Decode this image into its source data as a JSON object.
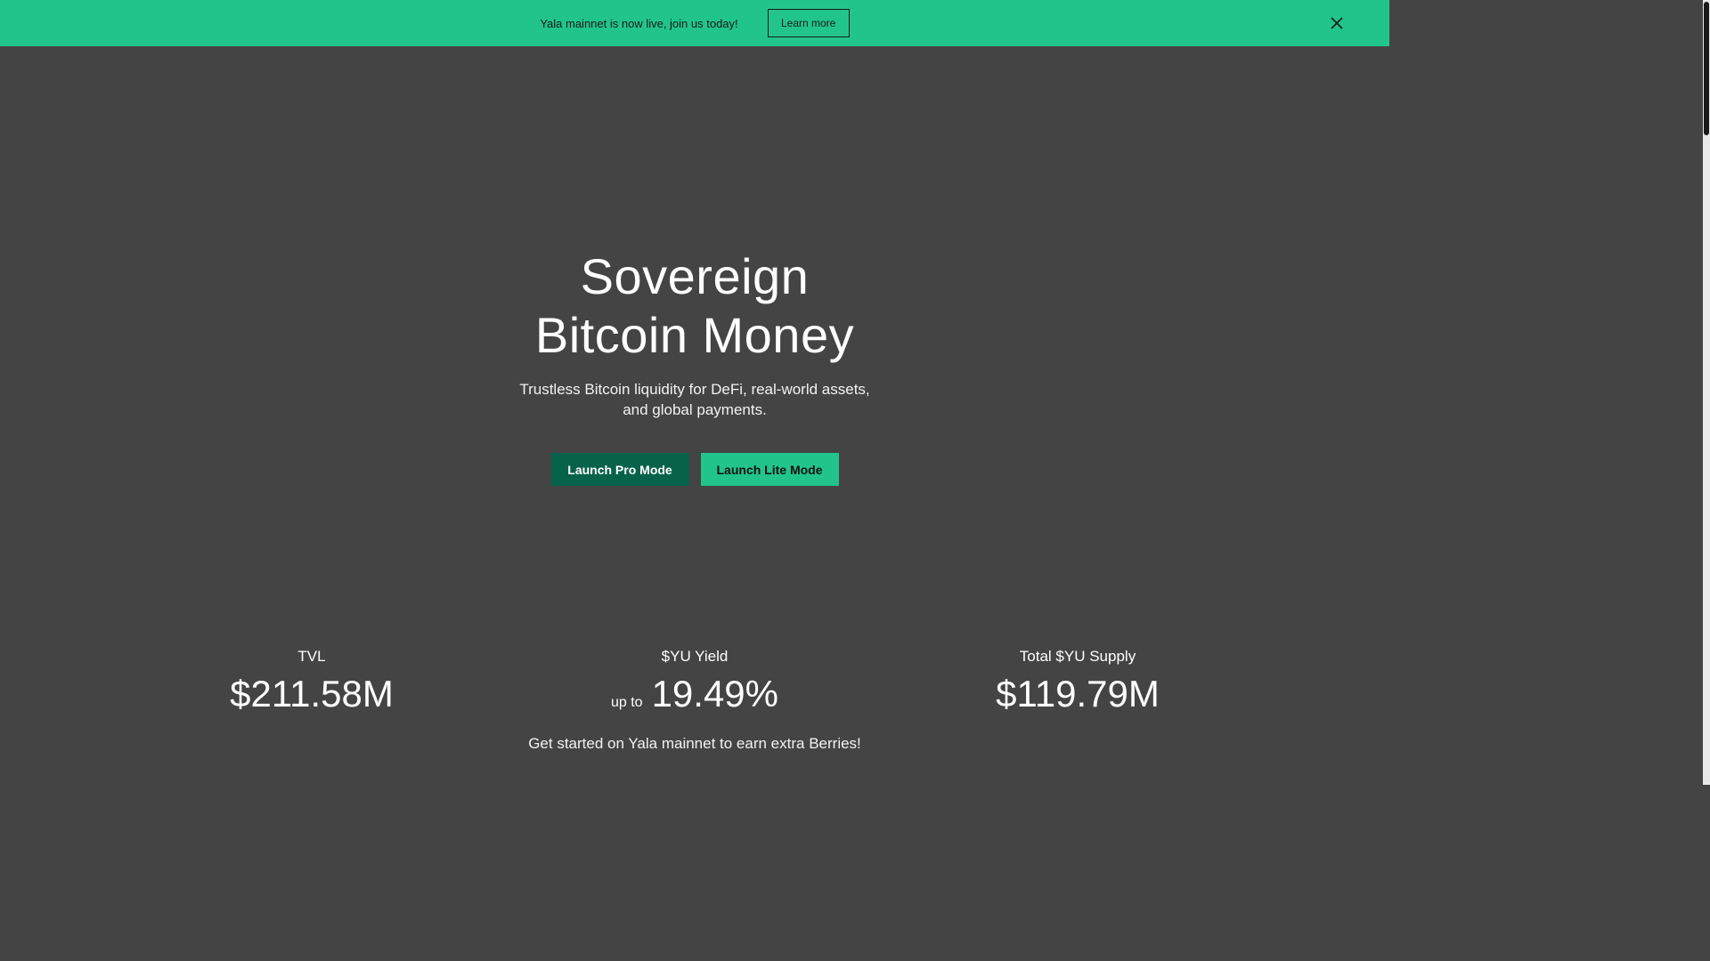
{
  "banner": {
    "text": "Yala mainnet is now live, join us today!",
    "button_label": "Learn more",
    "close_icon": "close-icon",
    "color": "#21c58b"
  },
  "hero": {
    "title_line1": "Sovereign",
    "title_line2": "Bitcoin Money",
    "subtitle": "Trustless Bitcoin liquidity for DeFi, real-world assets, and global payments.",
    "pro_button": "Launch Pro Mode",
    "lite_button": "Launch Lite Mode"
  },
  "stats": [
    {
      "label": "TVL",
      "prefix": "",
      "value": "$211.58M"
    },
    {
      "label": "$YU Yield",
      "prefix": "up to",
      "value": "19.49%"
    },
    {
      "label": "Total $YU Supply",
      "prefix": "",
      "value": "$119.79M"
    }
  ],
  "footer_note": "Get started on Yala mainnet to earn extra Berries!",
  "colors": {
    "background": "#444444",
    "accent": "#21c58b",
    "pro_button": "#07624a"
  }
}
